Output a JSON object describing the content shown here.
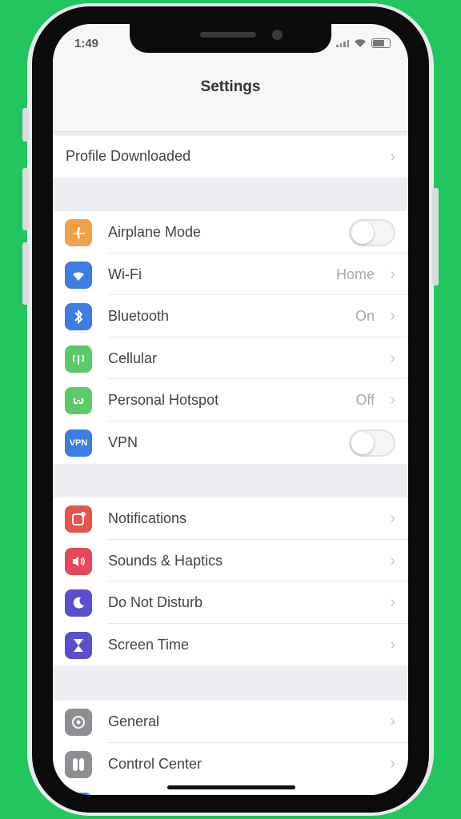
{
  "status": {
    "time": "1:49"
  },
  "nav": {
    "title": "Settings"
  },
  "profile": {
    "label": "Profile Downloaded"
  },
  "connectivity": [
    {
      "id": "airplane",
      "label": "Airplane Mode",
      "icon": "airplane-icon",
      "color": "#f0a24a",
      "control": "toggle",
      "toggle_on": false
    },
    {
      "id": "wifi",
      "label": "Wi-Fi",
      "value": "Home",
      "icon": "wifi-icon",
      "color": "#3b7de0",
      "control": "chevron"
    },
    {
      "id": "bluetooth",
      "label": "Bluetooth",
      "value": "On",
      "icon": "bluetooth-icon",
      "color": "#3b7de0",
      "control": "chevron"
    },
    {
      "id": "cellular",
      "label": "Cellular",
      "icon": "cellular-icon",
      "color": "#5cc96b",
      "control": "chevron"
    },
    {
      "id": "hotspot",
      "label": "Personal Hotspot",
      "value": "Off",
      "icon": "hotspot-icon",
      "color": "#5cc96b",
      "control": "chevron"
    },
    {
      "id": "vpn",
      "label": "VPN",
      "icon_text": "VPN",
      "icon": "vpn-icon",
      "color": "#3b7de0",
      "control": "toggle",
      "toggle_on": false
    }
  ],
  "alerts": [
    {
      "id": "notifications",
      "label": "Notifications",
      "icon": "notifications-icon",
      "color": "#e5534b"
    },
    {
      "id": "sounds",
      "label": "Sounds & Haptics",
      "icon": "sounds-icon",
      "color": "#e5485a"
    },
    {
      "id": "dnd",
      "label": "Do Not Disturb",
      "icon": "moon-icon",
      "color": "#5a4fcf"
    },
    {
      "id": "screentime",
      "label": "Screen Time",
      "icon": "hourglass-icon",
      "color": "#5a4fcf"
    }
  ],
  "system": [
    {
      "id": "general",
      "label": "General",
      "icon": "gear-icon",
      "color": "#8e8e93"
    },
    {
      "id": "controlcenter",
      "label": "Control Center",
      "icon": "control-center-icon",
      "color": "#8e8e93"
    }
  ]
}
